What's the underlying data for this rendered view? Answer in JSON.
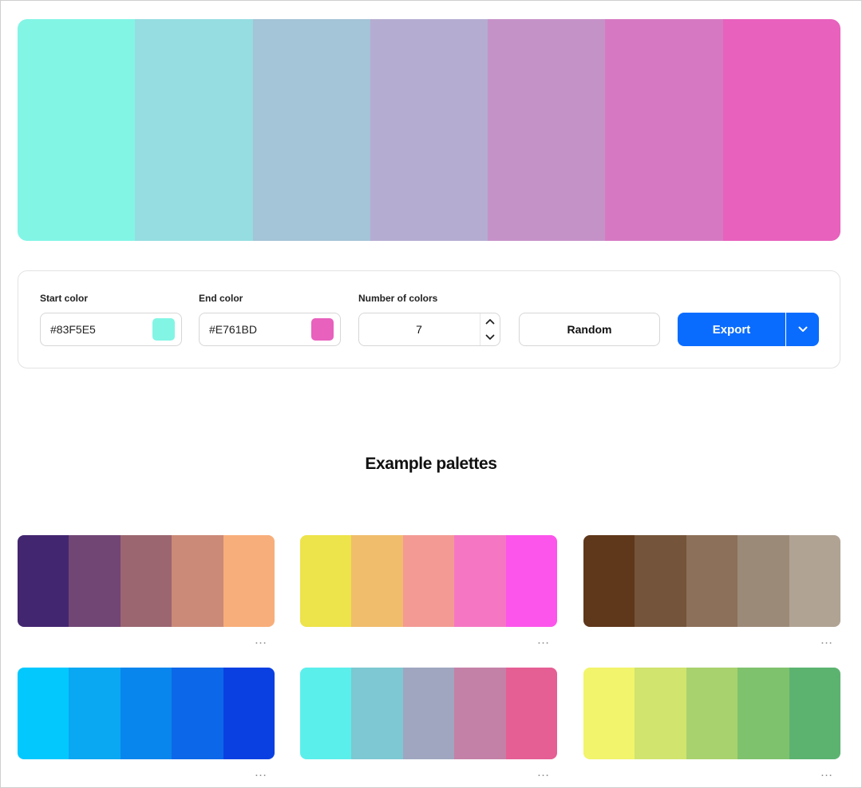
{
  "gradient": {
    "colors": [
      "#83F5E5",
      "#95DDE0",
      "#A4C4D7",
      "#B5ADD1",
      "#C592C8",
      "#D779C2",
      "#E761BD"
    ]
  },
  "controls": {
    "start_label": "Start color",
    "start_value": "#83F5E5",
    "start_color": "#83F5E5",
    "end_label": "End color",
    "end_value": "#E761BD",
    "end_color": "#E761BD",
    "count_label": "Number of colors",
    "count_value": "7",
    "random_label": "Random",
    "export_label": "Export"
  },
  "examples": {
    "title": "Example palettes",
    "more_label": "…",
    "palettes": [
      {
        "colors": [
          "#432670",
          "#714675",
          "#9B6670",
          "#CB8A78",
          "#F8AE7A"
        ]
      },
      {
        "colors": [
          "#EDE34A",
          "#F0BD6C",
          "#F49A94",
          "#F577C3",
          "#FC55EB"
        ]
      },
      {
        "colors": [
          "#5F371A",
          "#74543A",
          "#8C7059",
          "#9C8A78",
          "#B1A394"
        ]
      },
      {
        "colors": [
          "#02C8FE",
          "#0AA7F3",
          "#0886ED",
          "#0D67E9",
          "#0A40E2"
        ]
      },
      {
        "colors": [
          "#5BEFEC",
          "#7DC8D2",
          "#A0A6BF",
          "#C481A7",
          "#E55E94"
        ]
      },
      {
        "colors": [
          "#F2F46B",
          "#D0E46E",
          "#A8D26E",
          "#7FC26D",
          "#5CB370"
        ]
      }
    ]
  },
  "theme": {
    "accent": "#0A6CFF"
  }
}
